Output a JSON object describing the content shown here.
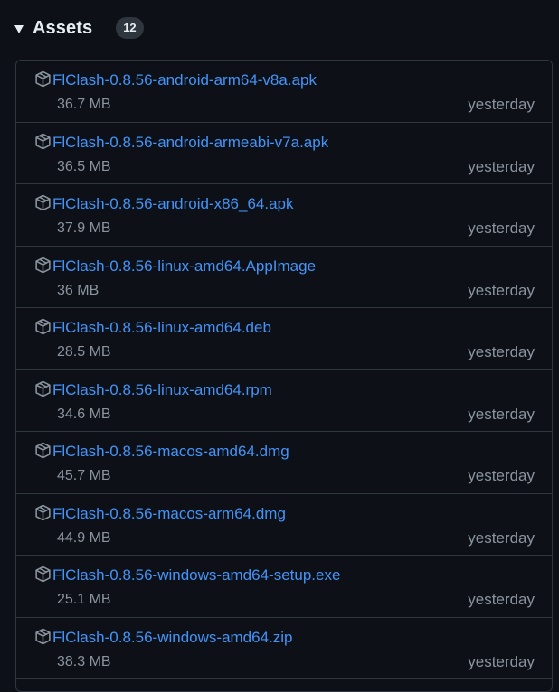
{
  "assets": {
    "title": "Assets",
    "count": "12",
    "items": [
      {
        "name": "FlClash-0.8.56-android-arm64-v8a.apk",
        "size": "36.7 MB",
        "date": "yesterday"
      },
      {
        "name": "FlClash-0.8.56-android-armeabi-v7a.apk",
        "size": "36.5 MB",
        "date": "yesterday"
      },
      {
        "name": "FlClash-0.8.56-android-x86_64.apk",
        "size": "37.9 MB",
        "date": "yesterday"
      },
      {
        "name": "FlClash-0.8.56-linux-amd64.AppImage",
        "size": "36 MB",
        "date": "yesterday"
      },
      {
        "name": "FlClash-0.8.56-linux-amd64.deb",
        "size": "28.5 MB",
        "date": "yesterday"
      },
      {
        "name": "FlClash-0.8.56-linux-amd64.rpm",
        "size": "34.6 MB",
        "date": "yesterday"
      },
      {
        "name": "FlClash-0.8.56-macos-amd64.dmg",
        "size": "45.7 MB",
        "date": "yesterday"
      },
      {
        "name": "FlClash-0.8.56-macos-arm64.dmg",
        "size": "44.9 MB",
        "date": "yesterday"
      },
      {
        "name": "FlClash-0.8.56-windows-amd64-setup.exe",
        "size": "25.1 MB",
        "date": "yesterday"
      },
      {
        "name": "FlClash-0.8.56-windows-amd64.zip",
        "size": "38.3 MB",
        "date": "yesterday"
      }
    ]
  },
  "icons": {
    "toggle": "caret-down-icon",
    "asset": "package-icon"
  },
  "colors": {
    "background": "#0d1117",
    "border": "#30363d",
    "link": "#4493f8",
    "muted": "#8b949e",
    "text": "#e6edf3"
  }
}
